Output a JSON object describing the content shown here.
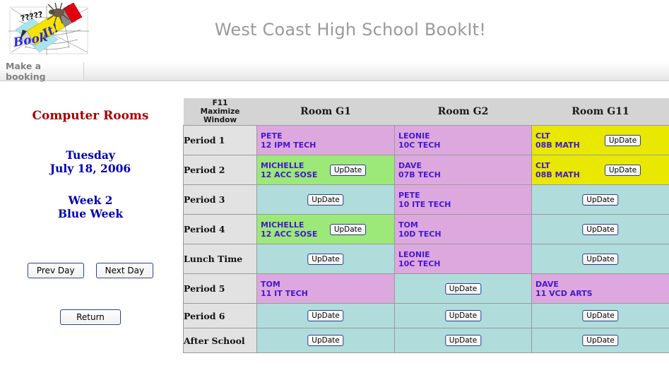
{
  "header": {
    "title": "West Coast High School BookIt!",
    "logo_alt": "Book It! spider web logo"
  },
  "tabs": [
    {
      "label": "Make a booking"
    }
  ],
  "sidebar": {
    "heading": "Computer Rooms",
    "day_name": "Tuesday",
    "date": "July 18, 2006",
    "week_number": "Week 2",
    "week_name": "Blue Week",
    "prev_day_label": "Prev Day",
    "next_day_label": "Next Day",
    "return_label": "Return"
  },
  "grid": {
    "corner_line1": "F11",
    "corner_line2": "Maximize Window",
    "update_label": "UpDate",
    "columns": [
      "Room G1",
      "Room G2",
      "Room G11"
    ],
    "rows": [
      {
        "period": "Period 1",
        "size": "tall",
        "cells": [
          {
            "state": "booked-other",
            "teacher": "PETE",
            "class": "12 IPM TECH",
            "update": false,
            "color": "#dda8de"
          },
          {
            "state": "booked-other",
            "teacher": "LEONIE",
            "class": "10C TECH",
            "update": false,
            "color": "#dda8de"
          },
          {
            "state": "booked-own",
            "teacher": "CLT",
            "class": "08B MATH",
            "update": true,
            "color": "#e8e800"
          }
        ]
      },
      {
        "period": "Period 2",
        "size": "tall",
        "cells": [
          {
            "state": "booked-own",
            "teacher": "MICHELLE",
            "class": "12 ACC SOSE",
            "update": true,
            "color": "#9ce878"
          },
          {
            "state": "booked-other",
            "teacher": "DAVE",
            "class": "07B TECH",
            "update": false,
            "color": "#dda8de"
          },
          {
            "state": "booked-own",
            "teacher": "CLT",
            "class": "08B MATH",
            "update": true,
            "color": "#e8e800"
          }
        ]
      },
      {
        "period": "Period 3",
        "size": "tall",
        "cells": [
          {
            "state": "free",
            "teacher": "",
            "class": "",
            "update": true,
            "color": "#b0dcdc"
          },
          {
            "state": "booked-other",
            "teacher": "PETE",
            "class": "10 ITE TECH",
            "update": false,
            "color": "#dda8de"
          },
          {
            "state": "free",
            "teacher": "",
            "class": "",
            "update": true,
            "color": "#b0dcdc"
          }
        ]
      },
      {
        "period": "Period 4",
        "size": "tall",
        "cells": [
          {
            "state": "booked-own",
            "teacher": "MICHELLE",
            "class": "12 ACC SOSE",
            "update": true,
            "color": "#9ce878"
          },
          {
            "state": "booked-other",
            "teacher": "TOM",
            "class": "10D TECH",
            "update": false,
            "color": "#dda8de"
          },
          {
            "state": "free",
            "teacher": "",
            "class": "",
            "update": true,
            "color": "#b0dcdc"
          }
        ]
      },
      {
        "period": "Lunch Time",
        "size": "tall",
        "cells": [
          {
            "state": "free",
            "teacher": "",
            "class": "",
            "update": true,
            "color": "#b0dcdc"
          },
          {
            "state": "booked-other",
            "teacher": "LEONIE",
            "class": "10C TECH",
            "update": false,
            "color": "#dda8de"
          },
          {
            "state": "free",
            "teacher": "",
            "class": "",
            "update": true,
            "color": "#b0dcdc"
          }
        ]
      },
      {
        "period": "Period 5",
        "size": "tall",
        "cells": [
          {
            "state": "booked-other",
            "teacher": "TOM",
            "class": "11 IT TECH",
            "update": false,
            "color": "#dda8de"
          },
          {
            "state": "free",
            "teacher": "",
            "class": "",
            "update": true,
            "color": "#b0dcdc"
          },
          {
            "state": "booked-other",
            "teacher": "DAVE",
            "class": "11 VCD ARTS",
            "update": false,
            "color": "#dda8de"
          }
        ]
      },
      {
        "period": "Period 6",
        "size": "short",
        "cells": [
          {
            "state": "free",
            "teacher": "",
            "class": "",
            "update": true,
            "color": "#b0dcdc"
          },
          {
            "state": "free",
            "teacher": "",
            "class": "",
            "update": true,
            "color": "#b0dcdc"
          },
          {
            "state": "free",
            "teacher": "",
            "class": "",
            "update": true,
            "color": "#b0dcdc"
          }
        ]
      },
      {
        "period": "After School",
        "size": "short",
        "cells": [
          {
            "state": "free",
            "teacher": "",
            "class": "",
            "update": true,
            "color": "#b0dcdc"
          },
          {
            "state": "free",
            "teacher": "",
            "class": "",
            "update": true,
            "color": "#b0dcdc"
          },
          {
            "state": "free",
            "teacher": "",
            "class": "",
            "update": true,
            "color": "#b0dcdc"
          }
        ]
      }
    ]
  },
  "colors": {
    "booked_other": "#dda8de",
    "booked_own_green": "#9ce878",
    "booked_own_yellow": "#e8e800",
    "free": "#b0dcdc",
    "row_label_bg": "#e2e2e2",
    "col_head_bg": "#d4d4d4",
    "title_gray": "#9a9a9a",
    "heading_red": "#a80000",
    "date_blue": "#0000b0",
    "booking_text": "#4417cf"
  }
}
